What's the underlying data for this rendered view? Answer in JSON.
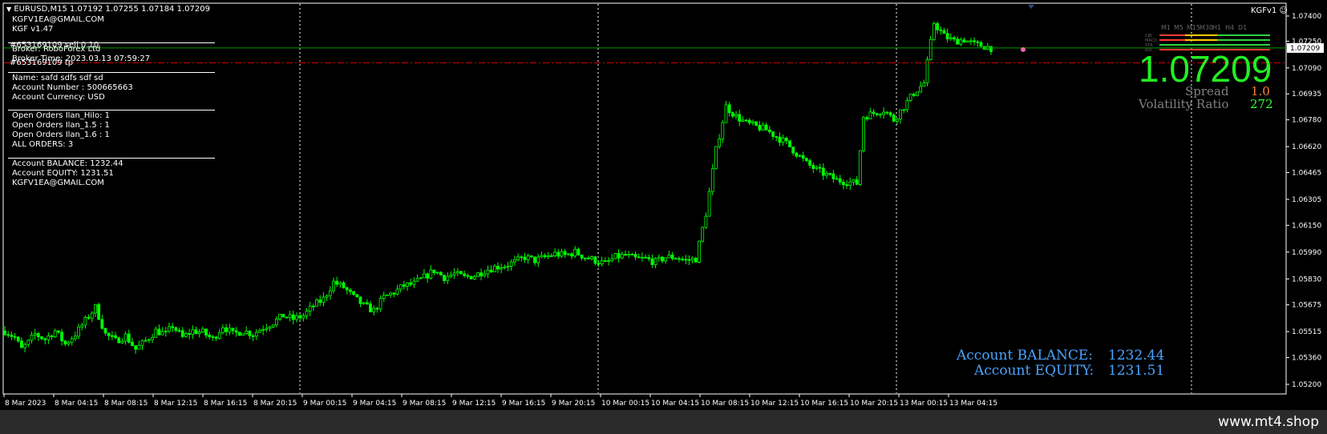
{
  "header": {
    "symbol_line": "EURUSD,M15  1.07192 1.07255 1.07184 1.07209",
    "email": "KGFV1EA@GMAIL.COM",
    "version": "KGF v1.47",
    "indicator_tag": "KGFv1"
  },
  "info_panel": {
    "ticket_line1": "#653169109 sell 0.10",
    "broker_line": "Broker: RoboForex Ltd",
    "ticket_line2": "#653169109 tp",
    "broker_time": "Broker Time: 2023.03.13 07:59:27",
    "name": "Name: safd    sdfs sdf  sd",
    "account_number": "Account Number : 500665663",
    "account_currency": "Account Currency: USD",
    "open_orders_hilo": "Open Orders Ilan_Hilo: 1",
    "open_orders_15": "Open Orders Ilan_1.5 : 1",
    "open_orders_16": "Open Orders Ilan_1.6 : 1",
    "all_orders": "ALL ORDERS: 3",
    "balance": "Account BALANCE: 1232.44",
    "equity": "Account EQUITY: 1231.51",
    "email": "KGFV1EA@GMAIL.COM"
  },
  "big_price": "1.07209",
  "spread": {
    "label": "Spread",
    "value": "1.0"
  },
  "volatility": {
    "label": "Volatility Ratio",
    "value": "272"
  },
  "account_big": {
    "balance_label": "Account BALANCE:",
    "balance_value": "1232.44",
    "equity_label": "Account EQUITY:",
    "equity_value": "1231.51"
  },
  "timeframe_panel": {
    "timeframes": [
      "M1",
      "M5",
      "M15",
      "M30",
      "H1",
      "H4",
      "D1"
    ],
    "rows": [
      "CJB",
      "MACD",
      "STR",
      "RSI"
    ]
  },
  "watermark": "www.mt4.shop",
  "colors": {
    "candle": "#00ff00",
    "price_line": "#009900",
    "order_line": "#cc0000",
    "account_text": "#4aa3ff",
    "spread_value": "#ff8040",
    "volatility_value": "#33ff33",
    "big_price": "#22ee22"
  },
  "chart_data": {
    "type": "candlestick",
    "y_ticks": [
      "1.07400",
      "1.07250",
      "1.07090",
      "1.06935",
      "1.06780",
      "1.06620",
      "1.06465",
      "1.06305",
      "1.06150",
      "1.05990",
      "1.05830",
      "1.05675",
      "1.05515",
      "1.05360",
      "1.05200"
    ],
    "ylim": [
      1.052,
      1.074
    ],
    "x_ticks": [
      "8 Mar 2023",
      "8 Mar 04:15",
      "8 Mar 08:15",
      "8 Mar 12:15",
      "8 Mar 16:15",
      "8 Mar 20:15",
      "9 Mar 00:15",
      "9 Mar 04:15",
      "9 Mar 08:15",
      "9 Mar 12:15",
      "9 Mar 16:15",
      "9 Mar 20:15",
      "10 Mar 00:15",
      "10 Mar 04:15",
      "10 Mar 08:15",
      "10 Mar 12:15",
      "10 Mar 16:15",
      "10 Mar 20:15",
      "13 Mar 00:15",
      "13 Mar 04:15"
    ],
    "current_price": "1.07209",
    "current_price_value": 1.07209,
    "order_price_value": 1.0712,
    "path": [
      [
        0,
        1.0552
      ],
      [
        3,
        1.0548
      ],
      [
        5,
        1.0541
      ],
      [
        7,
        1.0545
      ],
      [
        9,
        1.055
      ],
      [
        12,
        1.0547
      ],
      [
        15,
        1.0552
      ],
      [
        18,
        1.0544
      ],
      [
        21,
        1.055
      ],
      [
        24,
        1.0558
      ],
      [
        27,
        1.0566
      ],
      [
        30,
        1.055
      ],
      [
        33,
        1.0546
      ],
      [
        36,
        1.0549
      ],
      [
        39,
        1.0541
      ],
      [
        42,
        1.0546
      ],
      [
        45,
        1.0552
      ],
      [
        48,
        1.055
      ],
      [
        50,
        1.0555
      ],
      [
        53,
        1.0548
      ],
      [
        56,
        1.0552
      ],
      [
        59,
        1.0551
      ],
      [
        62,
        1.0547
      ],
      [
        65,
        1.0555
      ],
      [
        68,
        1.055
      ],
      [
        71,
        1.0552
      ],
      [
        74,
        1.055
      ],
      [
        77,
        1.0554
      ],
      [
        80,
        1.0557
      ],
      [
        83,
        1.0561
      ],
      [
        86,
        1.0559
      ],
      [
        89,
        1.0561
      ],
      [
        92,
        1.0567
      ],
      [
        95,
        1.0571
      ],
      [
        98,
        1.0581
      ],
      [
        101,
        1.0578
      ],
      [
        104,
        1.0572
      ],
      [
        107,
        1.0567
      ],
      [
        110,
        1.0564
      ],
      [
        113,
        1.0572
      ],
      [
        116,
        1.0575
      ],
      [
        119,
        1.0579
      ],
      [
        122,
        1.058
      ],
      [
        125,
        1.0584
      ],
      [
        128,
        1.0588
      ],
      [
        131,
        1.0584
      ],
      [
        134,
        1.0586
      ],
      [
        137,
        1.0584
      ],
      [
        140,
        1.0585
      ],
      [
        143,
        1.0588
      ],
      [
        146,
        1.059
      ],
      [
        149,
        1.0591
      ],
      [
        152,
        1.0593
      ],
      [
        155,
        1.0596
      ],
      [
        158,
        1.0594
      ],
      [
        161,
        1.0596
      ],
      [
        164,
        1.0598
      ],
      [
        167,
        1.0597
      ],
      [
        170,
        1.0599
      ],
      [
        173,
        1.0596
      ],
      [
        176,
        1.0594
      ],
      [
        179,
        1.0592
      ],
      [
        182,
        1.0596
      ],
      [
        185,
        1.0597
      ],
      [
        188,
        1.0595
      ],
      [
        191,
        1.0595
      ],
      [
        194,
        1.0593
      ],
      [
        197,
        1.0596
      ],
      [
        200,
        1.0596
      ],
      [
        203,
        1.0594
      ],
      [
        206,
        1.0595
      ],
      [
        209,
        1.0622
      ],
      [
        212,
        1.066
      ],
      [
        215,
        1.0686
      ],
      [
        218,
        1.068
      ],
      [
        221,
        1.0676
      ],
      [
        224,
        1.0674
      ],
      [
        227,
        1.0672
      ],
      [
        230,
        1.0668
      ],
      [
        233,
        1.0664
      ],
      [
        236,
        1.0658
      ],
      [
        239,
        1.0652
      ],
      [
        242,
        1.0648
      ],
      [
        245,
        1.0645
      ],
      [
        248,
        1.0642
      ],
      [
        251,
        1.0641
      ],
      [
        254,
        1.064
      ],
      [
        256,
        1.068
      ],
      [
        259,
        1.0682
      ],
      [
        262,
        1.0684
      ],
      [
        265,
        1.0678
      ],
      [
        268,
        1.0686
      ],
      [
        271,
        1.0694
      ],
      [
        274,
        1.07
      ],
      [
        277,
        1.0736
      ],
      [
        280,
        1.0728
      ],
      [
        283,
        1.0725
      ],
      [
        286,
        1.0726
      ],
      [
        289,
        1.0723
      ],
      [
        292,
        1.0722
      ],
      [
        294,
        1.0721
      ]
    ]
  }
}
